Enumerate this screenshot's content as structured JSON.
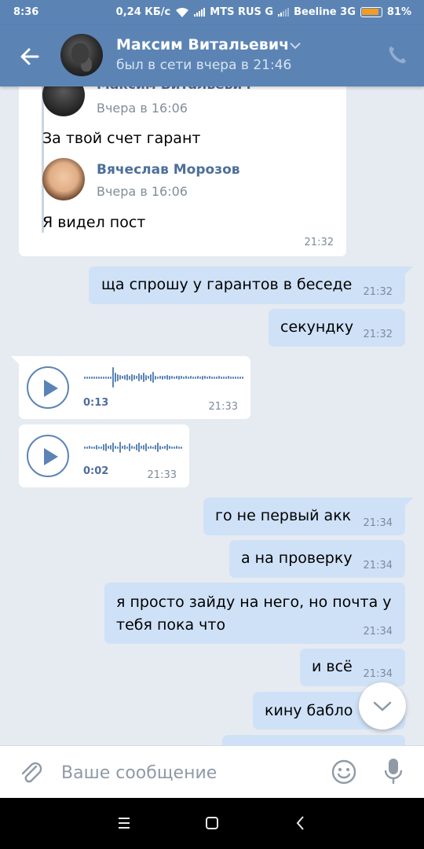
{
  "status_bar": {
    "time": "8:36",
    "speed": "0,24 КБ/с",
    "carrier1": "MTS RUS G",
    "carrier2": "Beeline 3G",
    "battery": "81%"
  },
  "header": {
    "name": "Максим Витальевич",
    "status": "был в сети вчера в 21:46"
  },
  "forwarded": {
    "msg1": {
      "sender": "Максим Витальевич",
      "date": "Вчера в 16:06",
      "text": "За твой счет гарант"
    },
    "msg2": {
      "sender": "Вячеслав Морозов",
      "date": "Вчера в 16:06",
      "text": "Я видел пост"
    },
    "time": "21:32"
  },
  "messages": {
    "m1": {
      "text": "ща спрошу у гарантов в беседе",
      "time": "21:32"
    },
    "m2": {
      "text": "секундку",
      "time": "21:32"
    },
    "voice1": {
      "duration": "0:13",
      "time": "21:33"
    },
    "voice2": {
      "duration": "0:02",
      "time": "21:33"
    },
    "m3": {
      "text": "го не первый акк",
      "time": "21:34"
    },
    "m4": {
      "text": "а на проверку",
      "time": "21:34"
    },
    "m5": {
      "line1": "я просто зайду на него, но почта у",
      "line2": "тебя пока что",
      "time": "21:34"
    },
    "m6": {
      "text": "и всё",
      "time": "21:34"
    },
    "m7": {
      "text": "кину бабло"
    }
  },
  "input": {
    "placeholder": "Ваше сообщение"
  },
  "icons": {
    "back": "arrow-left-icon",
    "call": "phone-icon",
    "attach": "paperclip-icon",
    "smile": "smile-icon",
    "mic": "microphone-icon",
    "scroll": "chevron-down-icon"
  },
  "colors": {
    "header": "#5b84b5",
    "outgoing_bubble": "#cfe1f7",
    "incoming_bubble": "#ffffff",
    "background": "#e6ebf1",
    "battery": "#f39c23"
  }
}
